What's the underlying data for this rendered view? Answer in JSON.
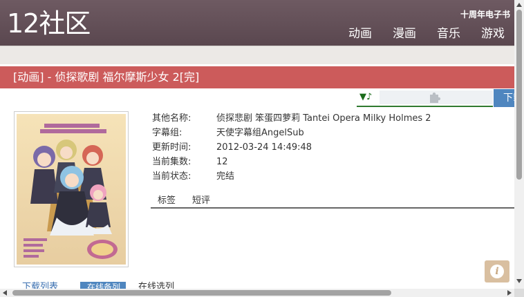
{
  "header": {
    "logo": "12社区",
    "promo": "十周年电子书",
    "nav": [
      "动画",
      "漫画",
      "音乐",
      "游戏"
    ]
  },
  "title": "[动画] - 侦探歌剧 福尔摩斯少女 2[完]",
  "toolbar": {
    "music_icon": "▼♪",
    "plugin_icon": "puzzle-icon",
    "download_label": "下载"
  },
  "info": [
    {
      "label": "其他名称:",
      "value": "侦探悲剧 笨蛋四萝莉 Tantei Opera Milky Holmes 2"
    },
    {
      "label": "字幕组:",
      "value": "天使字幕组AngelSub"
    },
    {
      "label": "更新时间:",
      "value": "2012-03-24 14:49:48"
    },
    {
      "label": "当前集数:",
      "value": "12"
    },
    {
      "label": "当前状态:",
      "value": "完结"
    }
  ],
  "tabs": [
    "标签",
    "短评"
  ],
  "bottom": {
    "link": "下载列表",
    "active": "在线备列",
    "text": "在线选列"
  },
  "colors": {
    "header_bg": "#5f4c54",
    "title_bar": "#cc5b5b",
    "accent_blue": "#4f86bf",
    "accent_green": "#2f7a2f"
  },
  "fab_icon": "info-icon"
}
